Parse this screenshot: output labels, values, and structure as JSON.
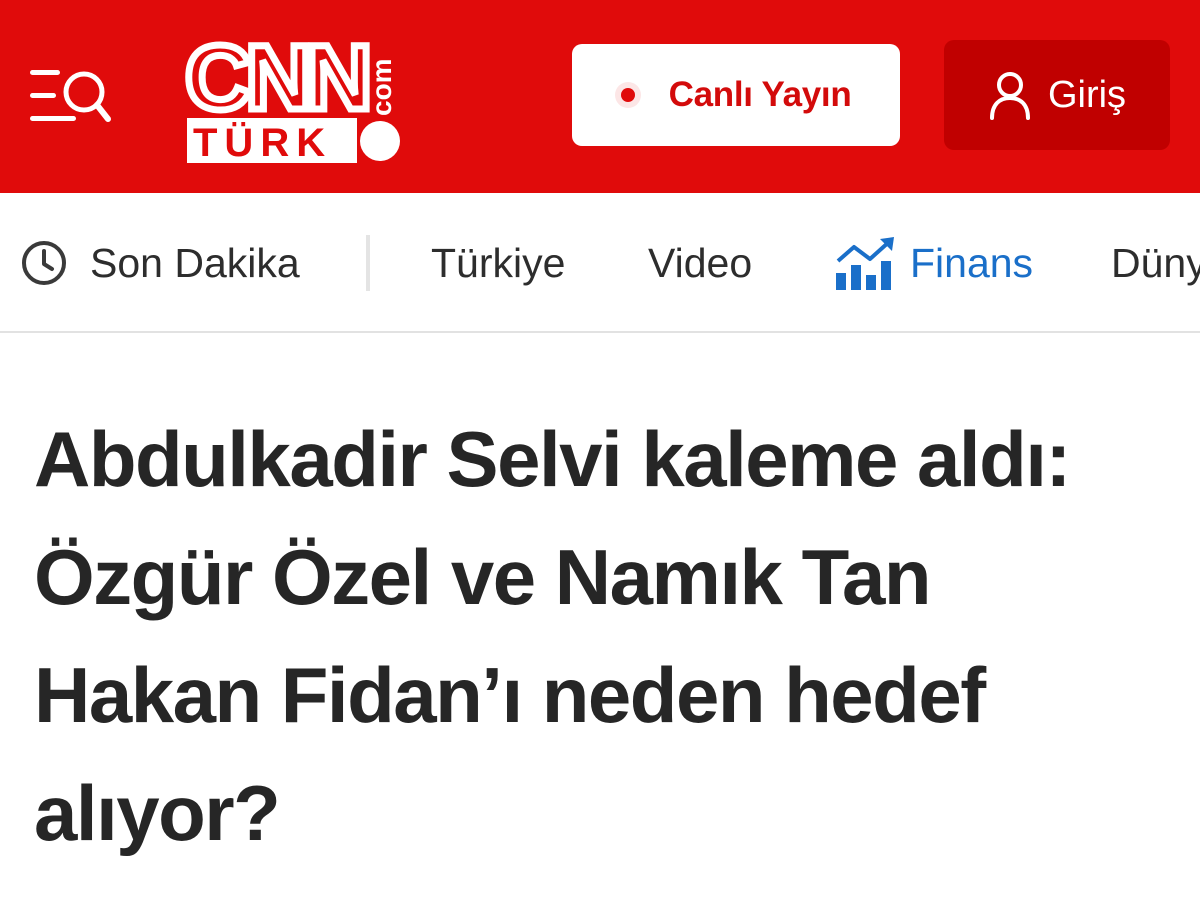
{
  "header": {
    "logo": {
      "brand": "CNN",
      "sub": "TÜRK",
      "dotcom": "com"
    },
    "live_button": {
      "label": "Canlı Yayın"
    },
    "login_button": {
      "label": "Giriş"
    },
    "colors": {
      "brand_red": "#e00b0b",
      "login_bg": "#c00000",
      "white": "#ffffff"
    },
    "icons": {
      "menu": "menu-search-icon",
      "live": "live-dot-icon",
      "user": "user-icon"
    }
  },
  "nav": {
    "items": [
      {
        "label": "Son Dakika",
        "icon": "clock-icon"
      },
      {
        "label": "Türkiye"
      },
      {
        "label": "Video"
      },
      {
        "label": "Finans",
        "icon": "finance-chart-icon",
        "color": "#1a6fc9"
      },
      {
        "label": "Dünya"
      }
    ]
  },
  "article": {
    "headline": "Abdulkadir Selvi kaleme aldı: Özgür Özel ve Namık Tan Hakan Fidan’ı neden hedef alıyor?"
  }
}
